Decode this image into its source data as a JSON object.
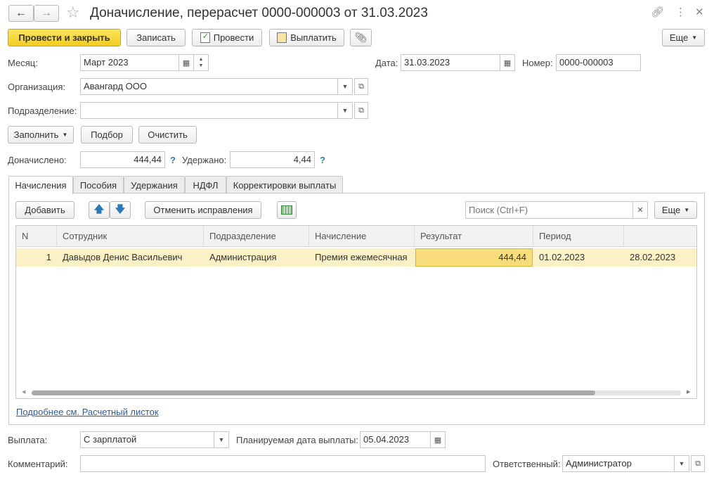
{
  "window": {
    "title": "Доначисление, перерасчет 0000-000003 от 31.03.2023"
  },
  "toolbar": {
    "post_close": "Провести и закрыть",
    "save": "Записать",
    "post": "Провести",
    "pay": "Выплатить",
    "more": "Еще"
  },
  "form": {
    "month_label": "Месяц:",
    "month_value": "Март 2023",
    "date_label": "Дата:",
    "date_value": "31.03.2023",
    "number_label": "Номер:",
    "number_value": "0000-000003",
    "org_label": "Организация:",
    "org_value": "Авангард ООО",
    "dept_label": "Подразделение:",
    "dept_value": "",
    "fill_btn": "Заполнить",
    "select_btn": "Подбор",
    "clear_btn": "Очистить",
    "accrued_label": "Доначислено:",
    "accrued_value": "444,44",
    "withheld_label": "Удержано:",
    "withheld_value": "4,44",
    "help": "?"
  },
  "tabs": [
    {
      "label": "Начисления"
    },
    {
      "label": "Пособия"
    },
    {
      "label": "Удержания"
    },
    {
      "label": "НДФЛ"
    },
    {
      "label": "Корректировки выплаты"
    }
  ],
  "grid_toolbar": {
    "add": "Добавить",
    "cancel_fixes": "Отменить исправления",
    "search_placeholder": "Поиск (Ctrl+F)",
    "more": "Еще"
  },
  "table": {
    "columns": [
      "N",
      "Сотрудник",
      "Подразделение",
      "Начисление",
      "Результат",
      "Период",
      ""
    ],
    "rows": [
      [
        "1",
        "Давыдов Денис Васильевич",
        "Администрация",
        "Премия ежемесячная",
        "444,44",
        "01.02.2023",
        "28.02.2023"
      ]
    ]
  },
  "link": "Подробнее см. Расчетный листок",
  "footer": {
    "payment_label": "Выплата:",
    "payment_value": "С зарплатой",
    "planned_date_label": "Планируемая дата выплаты:",
    "planned_date_value": "05.04.2023",
    "comment_label": "Комментарий:",
    "comment_value": "",
    "responsible_label": "Ответственный:",
    "responsible_value": "Администратор"
  },
  "colors": {
    "accent_yellow": "#f5d327",
    "selected_row": "#fbf1c6",
    "link": "#2a5e9c"
  }
}
